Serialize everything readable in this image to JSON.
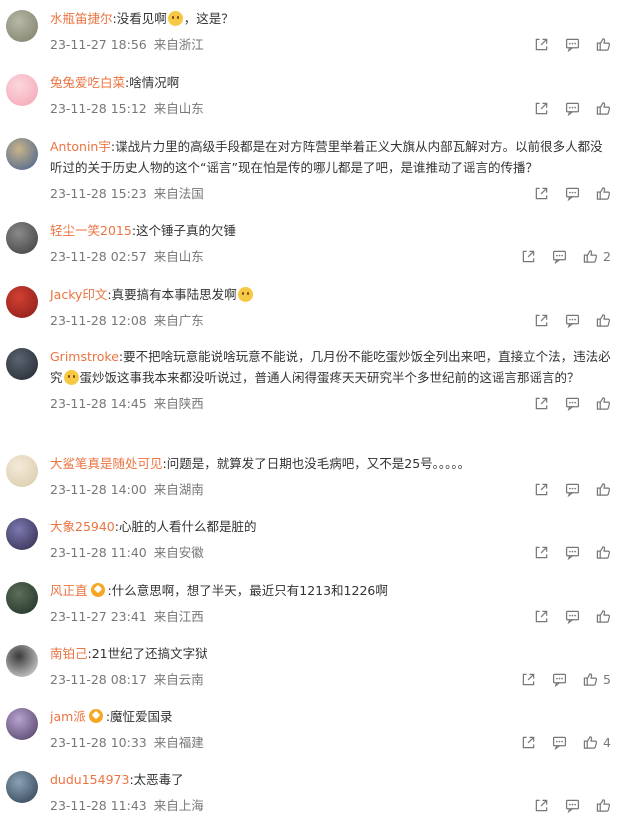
{
  "comments": [
    {
      "user": "水瓶笛捷尔",
      "vip": false,
      "text": "没看见啊",
      "emoji": "sweat-smile-emoji",
      "tail": "，这是？",
      "date": "23-11-27 18:56",
      "location": "来自浙江",
      "likes": ""
    },
    {
      "user": "兔兔爱吃白菜",
      "vip": false,
      "text": "啥情况啊",
      "emoji": "",
      "tail": "",
      "date": "23-11-28 15:12",
      "location": "来自山东",
      "likes": ""
    },
    {
      "user": "Antonin宇",
      "vip": false,
      "text": "谍战片力里的高级手段都是在对方阵营里举着正义大旗从内部瓦解对方。以前很多人都没听过的关于历史人物的这个“谣言”现在怕是传的哪儿都是了吧，是谁推动了谣言的传播？",
      "emoji": "",
      "tail": "",
      "date": "23-11-28 15:23",
      "location": "来自法国",
      "likes": ""
    },
    {
      "user": "轻尘一笑2015",
      "vip": false,
      "text": "这个锤子真的欠锤",
      "emoji": "",
      "tail": "",
      "date": "23-11-28 02:57",
      "location": "来自山东",
      "likes": "2"
    },
    {
      "user": "Jacky印文",
      "vip": false,
      "text": "真要搞有本事陆思发啊",
      "emoji": "laugh-emoji",
      "tail": "",
      "date": "23-11-28 12:08",
      "location": "来自广东",
      "likes": ""
    },
    {
      "user": "Grimstroke",
      "vip": false,
      "text": "要不把啥玩意能说啥玩意不能说，几月份不能吃蛋炒饭全列出来吧，直接立个法，违法必究",
      "emoji": "thinking-emoji",
      "tail": "蛋炒饭这事我本来都没听说过，普通人闲得蛋疼天天研究半个多世纪前的这谣言那谣言的？",
      "date": "23-11-28 14:45",
      "location": "来自陕西",
      "likes": ""
    },
    {
      "user": "大鲨笔真是随处可见",
      "vip": false,
      "text": "问题是，就算发了日期也没毛病吧，又不是25号。。。。。",
      "emoji": "",
      "tail": "",
      "date": "23-11-28 14:00",
      "location": "来自湖南",
      "likes": ""
    },
    {
      "user": "大象25940",
      "vip": false,
      "text": "心脏的人看什么都是脏的",
      "emoji": "",
      "tail": "",
      "date": "23-11-28 11:40",
      "location": "来自安徽",
      "likes": ""
    },
    {
      "user": "风正直",
      "vip": true,
      "text": "什么意思啊，想了半天，最近只有1213和1226啊",
      "emoji": "",
      "tail": "",
      "date": "23-11-27 23:41",
      "location": "来自江西",
      "likes": ""
    },
    {
      "user": "南铂己",
      "vip": false,
      "text": "21世纪了还搞文字狱",
      "emoji": "",
      "tail": "",
      "date": "23-11-28 08:17",
      "location": "来自云南",
      "likes": "5"
    },
    {
      "user": "jam派",
      "vip": true,
      "text": "魔怔爱国录",
      "emoji": "",
      "tail": "",
      "date": "23-11-28 10:33",
      "location": "来自福建",
      "likes": "4"
    },
    {
      "user": "dudu154973",
      "vip": false,
      "text": "太恶毒了",
      "emoji": "",
      "tail": "",
      "date": "23-11-28 11:43",
      "location": "来自上海",
      "likes": ""
    }
  ],
  "colors": {
    "username": "#eb7340",
    "meta": "#777777"
  }
}
